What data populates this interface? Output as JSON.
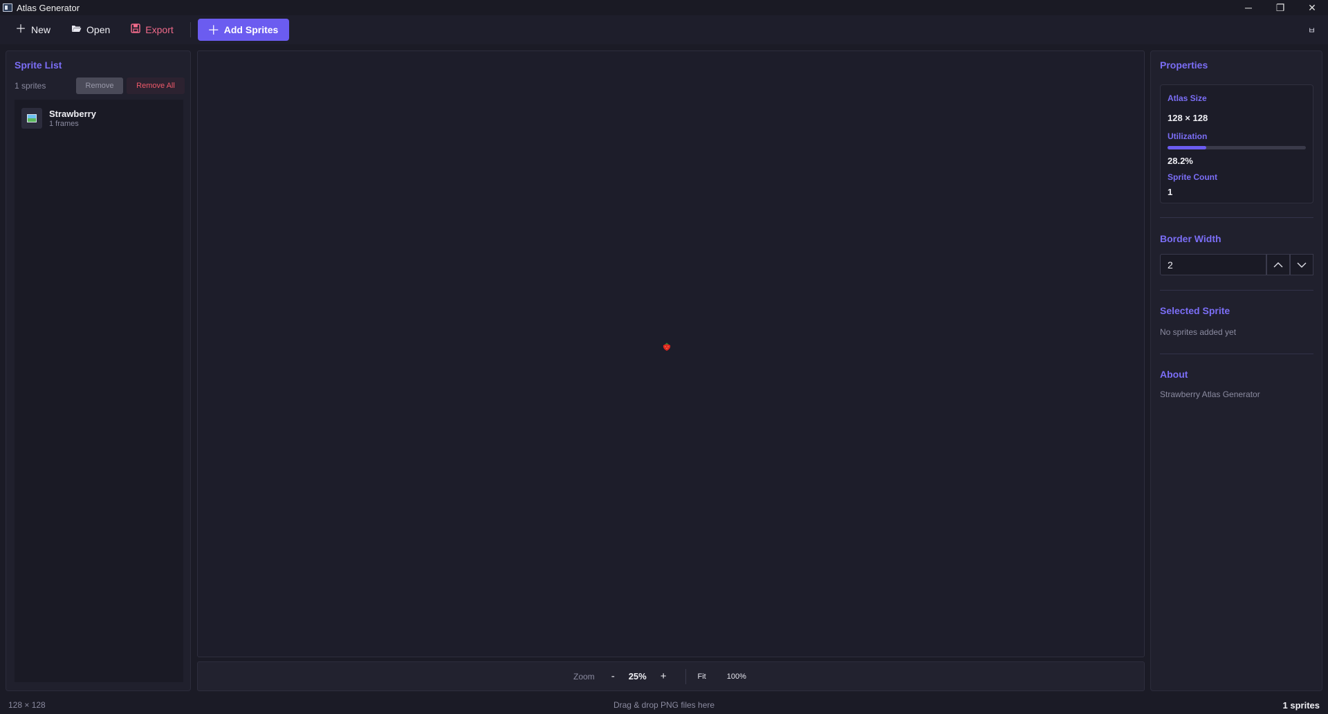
{
  "window": {
    "title": "Atlas Generator",
    "controls": {
      "minimize": "─",
      "maximize": "❐",
      "close": "✕"
    }
  },
  "toolbar": {
    "new_label": "New",
    "open_label": "Open",
    "export_label": "Export",
    "add_sprites_label": "Add Sprites",
    "right_icon": "ㅂ"
  },
  "sprite_list": {
    "title": "Sprite List",
    "count_label": "1 sprites",
    "remove_label": "Remove",
    "remove_all_label": "Remove All",
    "items": [
      {
        "name": "Strawberry",
        "frames": "1 frames",
        "icon": "image-icon"
      }
    ]
  },
  "canvas": {
    "sprites": [
      {
        "name": "Strawberry",
        "icon": "strawberry-icon"
      }
    ]
  },
  "zoom": {
    "label": "Zoom",
    "minus": "-",
    "value": "25%",
    "plus": "+",
    "fit_label": "Fit",
    "actual_label": "100%"
  },
  "properties": {
    "title": "Properties",
    "atlas_size_label": "Atlas Size",
    "atlas_size_value": "128 × 128",
    "utilization_label": "Utilization",
    "utilization_value": "28.2%",
    "utilization_fraction": 0.282,
    "sprite_count_label": "Sprite Count",
    "sprite_count_value": "1"
  },
  "border_width": {
    "title": "Border Width",
    "value": "2"
  },
  "selected_sprite": {
    "title": "Selected Sprite",
    "message": "No sprites added yet"
  },
  "about": {
    "title": "About",
    "text": "Strawberry Atlas Generator"
  },
  "statusbar": {
    "left": "128 × 128",
    "center": "Drag & drop PNG files here",
    "right": "1 sprites"
  },
  "colors": {
    "accent": "#6b5cf0",
    "accent_text": "#7b6ef6",
    "danger": "#f05a6a",
    "background": "#1b1b26"
  }
}
